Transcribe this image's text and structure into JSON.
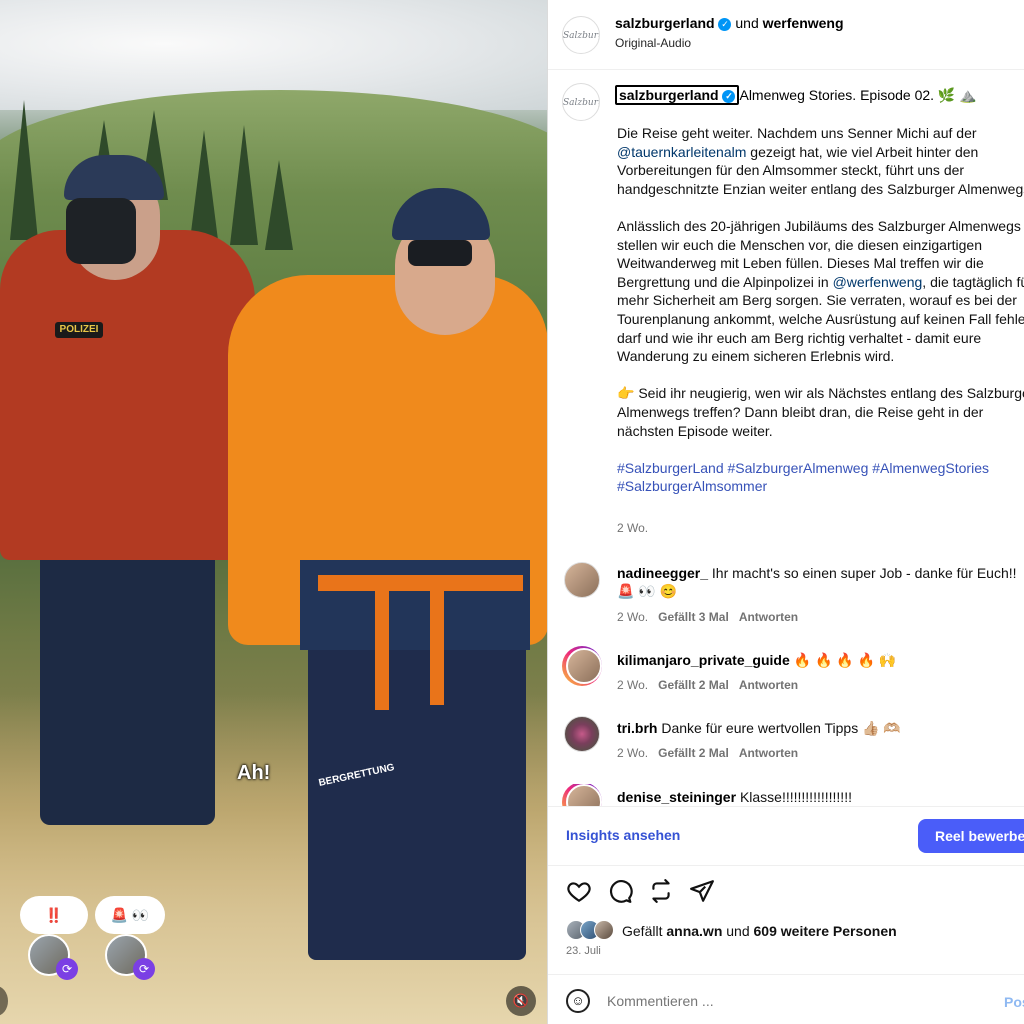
{
  "video": {
    "subtitle": "Ah!",
    "person1_badge": "POLIZEI",
    "person2_jacket_text": "BERGRETTUNG",
    "reactions": [
      {
        "emoji": "‼️"
      },
      {
        "emoji": "🚨 👀"
      }
    ],
    "mute_icon": "speaker-muted-icon"
  },
  "header": {
    "account": "salzburgerland",
    "joiner": "und",
    "collaborator": "werfenweng",
    "audio": "Original-Audio"
  },
  "caption": {
    "username": "salzburgerland",
    "title": "Almenweg Stories. Episode 02. 🌿 ⛰️",
    "p1_before": "Die Reise geht weiter. Nachdem uns Senner Michi auf der ",
    "p1_mention": "@tauernkarleitenalm",
    "p1_after": " gezeigt hat, wie viel Arbeit hinter den Vorbereitungen für den Almsommer steckt, führt uns der handgeschnitzte Enzian weiter entlang des Salzburger Almenwegs.",
    "p2_before": "Anlässlich des 20-jährigen Jubiläums des Salzburger Almenwegs stellen wir euch die Menschen vor, die diesen einzigartigen Weitwanderweg mit Leben füllen. Dieses Mal treffen wir die Bergrettung und die Alpinpolizei in ",
    "p2_mention": "@werfenweng",
    "p2_after": ", die tagtäglich für mehr Sicherheit am Berg sorgen. Sie verraten, worauf es bei der Tourenplanung ankommt, welche Ausrüstung auf keinen Fall fehlen darf und wie ihr euch am Berg richtig verhaltet - damit eure Wanderung zu einem sicheren Erlebnis wird.",
    "p3": "👉 Seid ihr neugierig, wen wir als Nächstes entlang des Salzburger Almenwegs treffen? Dann bleibt dran, die Reise geht in der nächsten Episode weiter.",
    "hashtags": "#SalzburgerLand #SalzburgerAlmenweg #AlmenwegStories #SalzburgerAlmsommer",
    "time": "2 Wo."
  },
  "comments": [
    {
      "user": "nadineegger_",
      "text": "Ihr macht's so einen super Job - danke für Euch!! 🚨 👀 😊",
      "time": "2 Wo.",
      "likes": "Gefällt 3 Mal",
      "reply": "Antworten"
    },
    {
      "user": "kilimanjaro_private_guide",
      "text": "🔥 🔥 🔥 🔥 🙌",
      "time": "2 Wo.",
      "likes": "Gefällt 2 Mal",
      "reply": "Antworten"
    },
    {
      "user": "tri.brh",
      "text": "Danke für eure wertvollen Tipps 👍🏼 🫶🏼",
      "time": "2 Wo.",
      "likes": "Gefällt 2 Mal",
      "reply": "Antworten"
    },
    {
      "user": "denise_steininger",
      "text": "Klasse!!!!!!!!!!!!!!!!!!"
    }
  ],
  "insights": {
    "link": "Insights ansehen",
    "boost": "Reel bewerben"
  },
  "likes": {
    "prefix": "Gefällt",
    "user": "anna.wn",
    "joiner": "und",
    "others": "609 weitere Personen",
    "date": "23. Juli"
  },
  "comment_box": {
    "placeholder": "Kommentieren ...",
    "post": "Posten"
  },
  "colors": {
    "link_blue": "#3552d4",
    "button_blue": "#4a5df9",
    "verified_blue": "#0095f6",
    "repost_purple": "#7b3fe4"
  }
}
